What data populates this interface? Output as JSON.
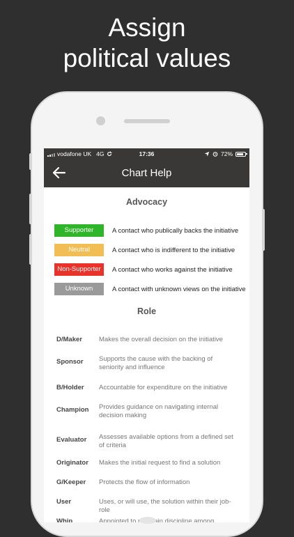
{
  "headline": {
    "line1": "Assign",
    "line2": "political values"
  },
  "status_bar": {
    "carrier": "vodafone UK",
    "network": "4G",
    "time": "17:36",
    "battery": "72%"
  },
  "nav": {
    "title": "Chart Help",
    "back_icon": "arrow-left-icon"
  },
  "advocacy": {
    "title": "Advocacy",
    "items": [
      {
        "label": "Supporter",
        "color": "#2fb52a",
        "desc": "A contact who publically backs the initiative"
      },
      {
        "label": "Neutral",
        "color": "#f1bd54",
        "desc": "A contact who is indifferent to the initiative"
      },
      {
        "label": "Non-Supporter",
        "color": "#e8322a",
        "desc": "A contact who works against the initiative"
      },
      {
        "label": "Unknown",
        "color": "#9a9a9a",
        "desc": "A contact with unknown views on the initiative"
      }
    ]
  },
  "role": {
    "title": "Role",
    "items": [
      {
        "term": "D/Maker",
        "desc": "Makes the overall decision on the initiative"
      },
      {
        "term": "Sponsor",
        "desc": "Supports the cause with the backing of seniority and influence"
      },
      {
        "term": "B/Holder",
        "desc": "Accountable for expenditure on the initiative"
      },
      {
        "term": "Champion",
        "desc": "Provides guidance on navigating internal decision making"
      },
      {
        "term": "Evaluator",
        "desc": "Assesses available options from a defined set of criteria"
      },
      {
        "term": "Originator",
        "desc": "Makes the initial request to find a solution"
      },
      {
        "term": "G/Keeper",
        "desc": "Protects the flow of information"
      },
      {
        "term": "User",
        "desc": "Uses, or will use, the solution within their job-role"
      },
      {
        "term": "Whip",
        "desc": "Appointed to maintain discipline among members"
      }
    ]
  }
}
